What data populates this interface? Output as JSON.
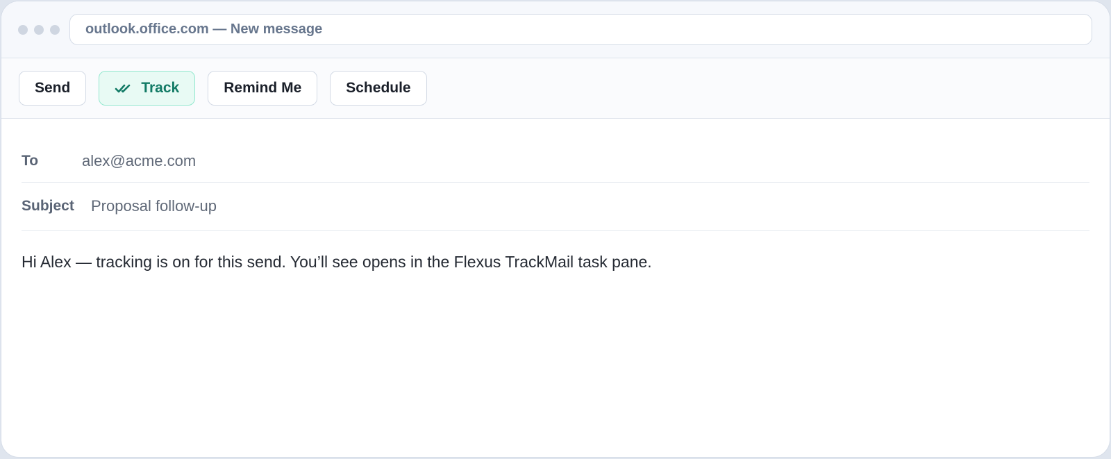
{
  "window": {
    "address": "outlook.office.com — New message"
  },
  "toolbar": {
    "buttons": [
      {
        "label": "Send",
        "active": false
      },
      {
        "label": "Track",
        "active": true,
        "icon": "double-check-icon"
      },
      {
        "label": "Remind Me",
        "active": false
      },
      {
        "label": "Schedule",
        "active": false
      }
    ]
  },
  "compose": {
    "to_label": "To",
    "to_value": "alex@acme.com",
    "subject_label": "Subject",
    "subject_value": "Proposal follow-up",
    "body": "Hi Alex — tracking is on for this send. You’ll see opens in the Flexus TrackMail task pane."
  },
  "colors": {
    "accent": "#127a65",
    "accent_bg": "#e8faf4",
    "accent_border": "#94e8cf"
  }
}
